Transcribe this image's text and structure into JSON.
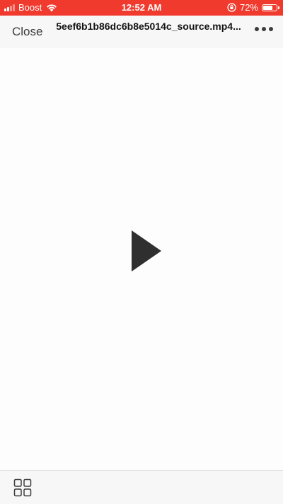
{
  "status_bar": {
    "background": "#f03a2e",
    "carrier": "Boost",
    "time": "12:52 AM",
    "battery_percent": "72%",
    "battery_level": 0.72,
    "icons": [
      "signal-bars-icon",
      "wifi-icon",
      "orientation-lock-icon",
      "battery-icon"
    ]
  },
  "nav": {
    "close_label": "Close",
    "title": "5eef6b1b86dc6b8e5014c_source.mp4...",
    "more_icon": "more-dots-icon"
  },
  "content": {
    "play_icon": "play-icon",
    "play_color": "#2f2f2f"
  },
  "toolbar": {
    "grid_icon": "grid-view-icon"
  }
}
